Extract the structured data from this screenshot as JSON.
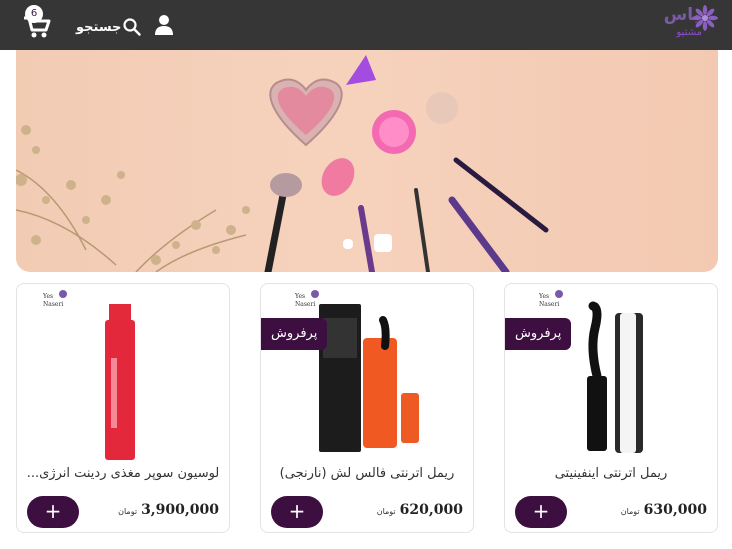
{
  "header": {
    "cart_count": "6",
    "search_label": "جستجو",
    "logo_text": "یاس",
    "logo_subtext": "مشتیو"
  },
  "hero": {
    "active_slide": 2,
    "slide_count": 2
  },
  "colors": {
    "header_bg": "#363636",
    "accent": "#3d0f40"
  },
  "products": [
    {
      "title": "ریمل اترنتی اینفینیتی",
      "price": "630,000",
      "currency": "تومان",
      "badge": "پرفروش",
      "add_label": "+",
      "icon": "mascara-image"
    },
    {
      "title": "ریمل اترنتی فالس لش (نارنجی)",
      "price": "620,000",
      "currency": "تومان",
      "badge": "پرفروش",
      "add_label": "+",
      "icon": "mascara-orange-image"
    },
    {
      "title": "لوسیون سوپر مغذی ردینت انرژی...",
      "price": "3,900,000",
      "currency": "تومان",
      "badge": "",
      "add_label": "+",
      "icon": "lotion-bottle-image"
    }
  ]
}
